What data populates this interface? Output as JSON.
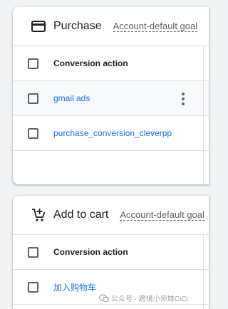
{
  "purchase": {
    "title": "Purchase",
    "goal_label": "Account-default goal",
    "column_header": "Conversion action",
    "rows": [
      {
        "label": "gmail ads"
      },
      {
        "label": "purchase_conversion_cleverpp"
      }
    ],
    "icon": "credit-card-icon"
  },
  "add_to_cart": {
    "title": "Add to cart",
    "goal_label": "Account-default goal",
    "column_header": "Conversion action",
    "rows": [
      {
        "label": "加入购物车"
      }
    ],
    "icon": "add-shopping-cart-icon"
  },
  "watermark": {
    "text": "公众号 · 跨境小师妹CiCi"
  },
  "colors": {
    "link": "#1a73e8",
    "text": "#202124",
    "secondary": "#5f6368",
    "background": "#f1f3f4"
  }
}
